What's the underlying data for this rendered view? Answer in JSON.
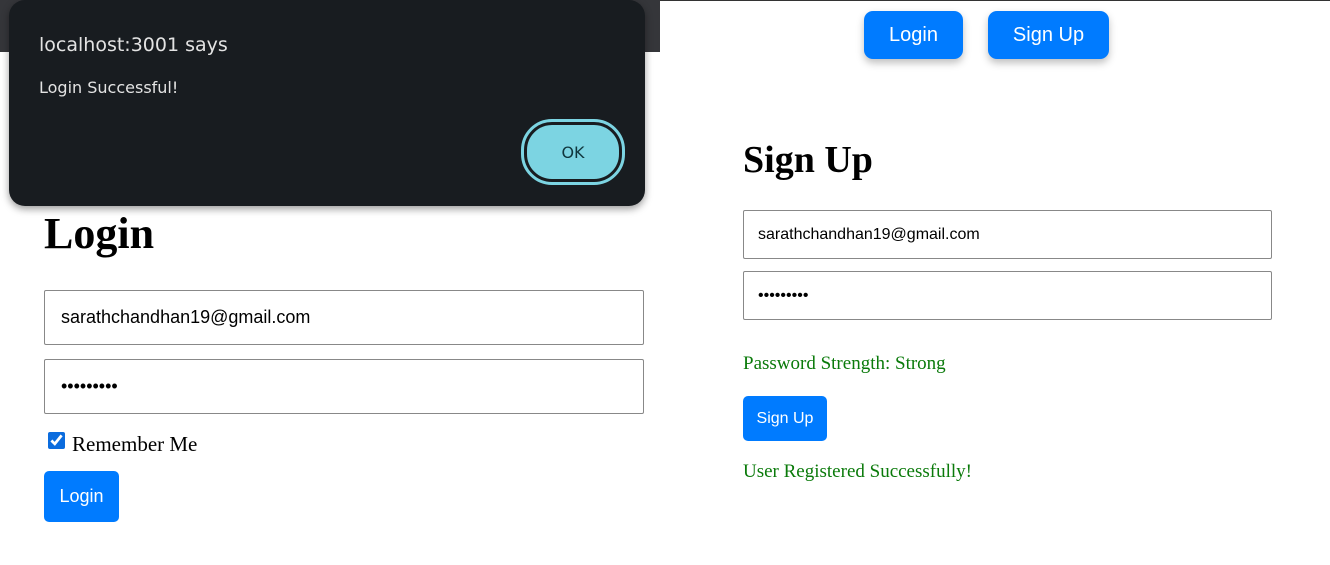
{
  "dialog": {
    "title": "localhost:3001 says",
    "message": "Login Successful!",
    "ok_label": "OK"
  },
  "nav": {
    "login_label": "Login",
    "signup_label": "Sign Up"
  },
  "login": {
    "heading": "Login",
    "email": "sarathchandhan19@gmail.com",
    "password": "•••••••••",
    "remember_label": "Remember Me",
    "remember_checked": true,
    "button_label": "Login"
  },
  "signup": {
    "heading": "Sign Up",
    "email": "sarathchandhan19@gmail.com",
    "password": "•••••••••",
    "strength": "Password Strength: Strong",
    "button_label": "Sign Up",
    "status": "User Registered Successfully!"
  }
}
